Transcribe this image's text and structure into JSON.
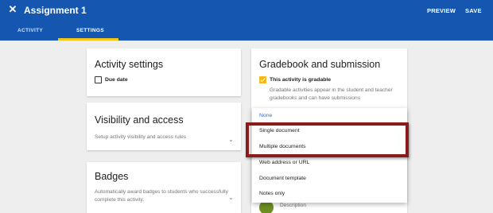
{
  "header": {
    "close_glyph": "✕",
    "title": "Assignment 1",
    "preview_label": "PREVIEW",
    "save_label": "SAVE"
  },
  "tabs": [
    {
      "label": "ACTIVITY",
      "active": false
    },
    {
      "label": "SETTINGS",
      "active": true
    }
  ],
  "activity_settings": {
    "title": "Activity settings",
    "due_date_label": "Due date",
    "due_date_checked": false
  },
  "visibility": {
    "title": "Visibility and access",
    "description": "Setup activity visibility and access rules"
  },
  "badges": {
    "title": "Badges",
    "description": "Automatically award badges to students who successfully complete this activity."
  },
  "gradebook": {
    "title": "Gradebook and submission",
    "gradable_label": "This activity is gradable",
    "gradable_checked": true,
    "gradable_description": "Gradable activities appear in the student and teacher gradebooks and can have submissions",
    "bottom_description": "Description"
  },
  "submission_dropdown": {
    "selected": "None",
    "options": [
      "None",
      "Single document",
      "Multiple documents",
      "Web address or URL",
      "Document template",
      "Notes only"
    ]
  },
  "colors": {
    "header_bg": "#1557b0",
    "accent": "#f5c518",
    "highlight": "#8b1a1a",
    "selected_option": "#1a73e8"
  }
}
